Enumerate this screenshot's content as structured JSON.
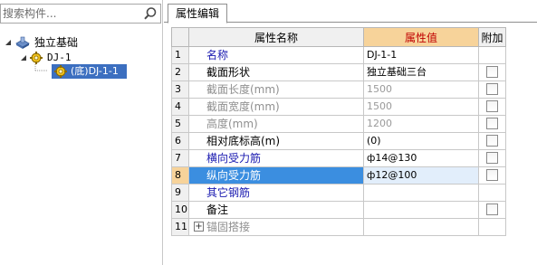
{
  "search": {
    "placeholder": "搜索构件..."
  },
  "tree": {
    "root_label": "独立基础",
    "child_label": "DJ-1",
    "grandchild_label": "(底)DJ-1-1"
  },
  "tabs": [
    {
      "label": "属性编辑"
    }
  ],
  "grid": {
    "headers": {
      "num": "",
      "name": "属性名称",
      "value": "属性值",
      "extra": "附加"
    },
    "rows": [
      {
        "num": "1",
        "name": "名称",
        "value": "DJ-1-1",
        "style": "blue",
        "checkbox": false
      },
      {
        "num": "2",
        "name": "截面形状",
        "value": "独立基础三台",
        "style": "normal",
        "checkbox": true
      },
      {
        "num": "3",
        "name": "截面长度(mm)",
        "value": "1500",
        "style": "gray",
        "checkbox": true
      },
      {
        "num": "4",
        "name": "截面宽度(mm)",
        "value": "1500",
        "style": "gray",
        "checkbox": true
      },
      {
        "num": "5",
        "name": "高度(mm)",
        "value": "1200",
        "style": "gray",
        "checkbox": true
      },
      {
        "num": "6",
        "name": "相对底标高(m)",
        "value": "(0)",
        "style": "normal",
        "checkbox": true
      },
      {
        "num": "7",
        "name": "横向受力筋",
        "value": "ф14@130",
        "style": "blue",
        "checkbox": true
      },
      {
        "num": "8",
        "name": "纵向受力筋",
        "value": "ф12@100",
        "style": "blue",
        "checkbox": true
      },
      {
        "num": "9",
        "name": "其它钢筋",
        "value": "",
        "style": "blue",
        "checkbox": false
      },
      {
        "num": "10",
        "name": "备注",
        "value": "",
        "style": "normal",
        "checkbox": true
      },
      {
        "num": "11",
        "name": "锚固搭接",
        "value": "",
        "style": "gray-group",
        "checkbox": false
      }
    ],
    "selected_row_num": "8"
  },
  "colors": {
    "selection": "#3c6fc0",
    "value_header_bg": "#f7d39a",
    "value_header_text": "#c00000",
    "property_link": "#1a1ab0"
  }
}
